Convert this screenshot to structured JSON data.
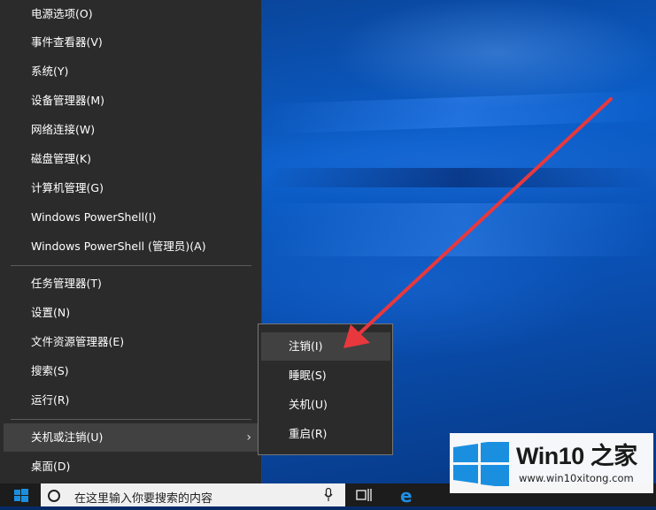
{
  "context_menu": {
    "group1": [
      {
        "label": "电源选项(O)"
      },
      {
        "label": "事件查看器(V)"
      },
      {
        "label": "系统(Y)"
      },
      {
        "label": "设备管理器(M)"
      },
      {
        "label": "网络连接(W)"
      },
      {
        "label": "磁盘管理(K)"
      },
      {
        "label": "计算机管理(G)"
      },
      {
        "label": "Windows PowerShell(I)"
      },
      {
        "label": "Windows PowerShell (管理员)(A)"
      }
    ],
    "group2": [
      {
        "label": "任务管理器(T)"
      },
      {
        "label": "设置(N)"
      },
      {
        "label": "文件资源管理器(E)"
      },
      {
        "label": "搜索(S)"
      },
      {
        "label": "运行(R)"
      }
    ],
    "shutdown_item": {
      "label": "关机或注销(U)",
      "arrow": "›"
    },
    "desktop_item": {
      "label": "桌面(D)"
    }
  },
  "submenu": {
    "items": [
      {
        "label": "注销(I)"
      },
      {
        "label": "睡眠(S)"
      },
      {
        "label": "关机(U)"
      },
      {
        "label": "重启(R)"
      }
    ]
  },
  "taskbar": {
    "search_placeholder": "在这里输入你要搜索的内容",
    "edge_glyph": "e"
  },
  "watermark": {
    "title": "Win10 之家",
    "url": "www.win10xitong.com"
  },
  "colors": {
    "menu_bg": "#2b2b2b",
    "highlight": "#414141",
    "arrow": "#e8383d",
    "logo_blue": "#1a8fe0"
  }
}
